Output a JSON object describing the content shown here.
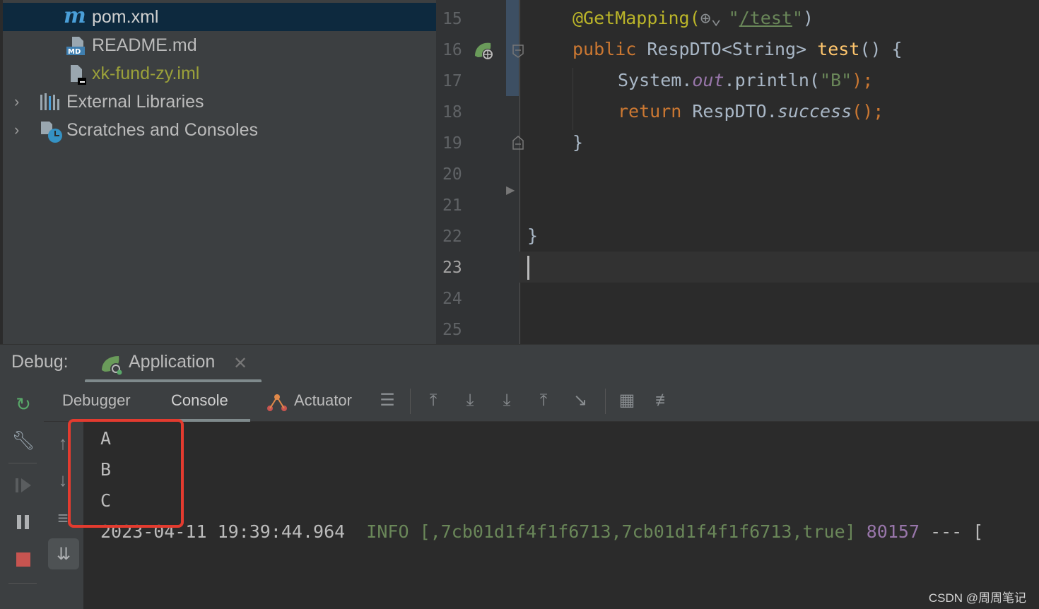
{
  "project_tree": {
    "items": [
      {
        "label": "pom.xml",
        "icon": "maven-icon",
        "selected": true
      },
      {
        "label": "README.md",
        "icon": "markdown-file-icon"
      },
      {
        "label": "xk-fund-zy.iml",
        "icon": "iml-file-icon"
      },
      {
        "label": "External Libraries",
        "icon": "libraries-icon",
        "expandable": true
      },
      {
        "label": "Scratches and Consoles",
        "icon": "scratches-icon",
        "expandable": true
      }
    ]
  },
  "editor": {
    "line_numbers": [
      "15",
      "16",
      "17",
      "18",
      "19",
      "20",
      "21",
      "22",
      "23",
      "24",
      "25"
    ],
    "current_line": "23",
    "code": {
      "l15_ann": "@GetMapping(",
      "l15_str_open": "\"",
      "l15_url": "/test",
      "l15_str_close": "\"",
      "l15_close": ")",
      "l16_kw": "public ",
      "l16_type": "RespDTO<String> ",
      "l16_fn": "test",
      "l16_rest": "() {",
      "l17_a": "System.",
      "l17_out": "out",
      "l17_b": ".println(",
      "l17_str": "\"B\"",
      "l17_c": ");",
      "l18_kw": "return ",
      "l18_a": "RespDTO.",
      "l18_fn": "success",
      "l18_c": "();",
      "l19": "}",
      "l22": "}"
    }
  },
  "debug": {
    "title": "Debug:",
    "run_config": "Application",
    "tabs": [
      "Debugger",
      "Console",
      "Actuator"
    ],
    "active_tab": "Console",
    "console_lines": [
      "A",
      "B",
      "C"
    ],
    "log": {
      "timestamp": "2023-04-11 19:39:44.964",
      "level": "INFO",
      "trace": "[,7cb01d1f4f1f6713,7cb01d1f4f1f6713,true]",
      "pid": "80157",
      "sep": "--- ["
    }
  },
  "watermark": "CSDN @周周笔记",
  "colors": {
    "keyword": "#cc7832",
    "annotation": "#bbb529",
    "string": "#6a8759",
    "highlight_box": "#e33b2f"
  }
}
